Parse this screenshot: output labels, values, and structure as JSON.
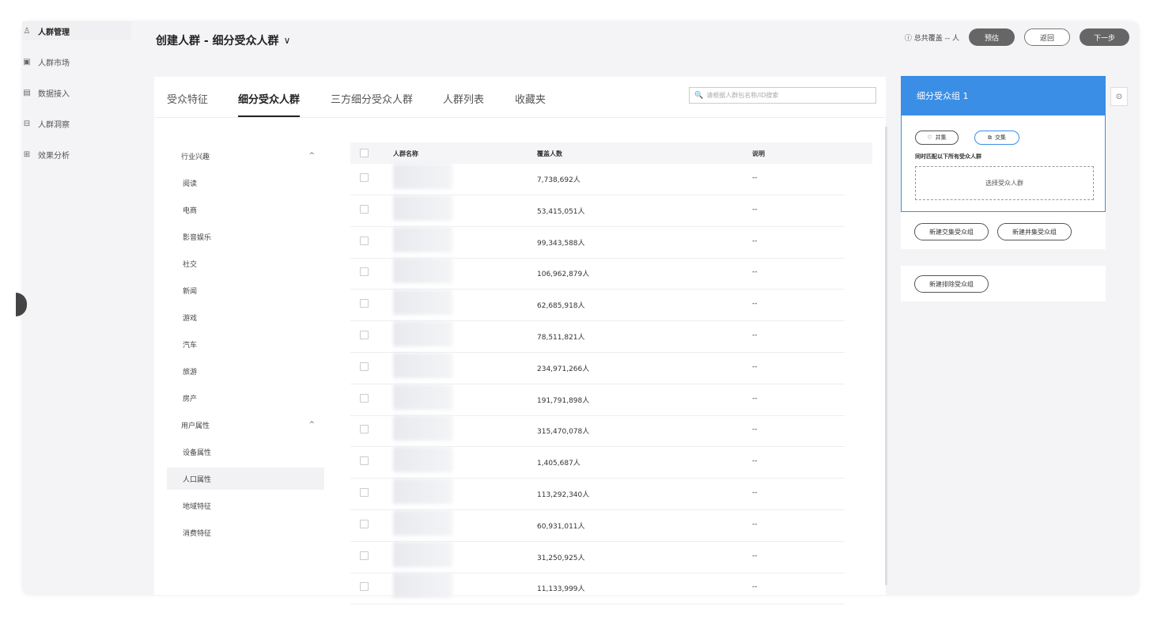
{
  "sidebar": {
    "items": [
      {
        "icon": "user-group-icon",
        "glyph": "♙",
        "label": "人群管理"
      },
      {
        "icon": "market-icon",
        "glyph": "▣",
        "label": "人群市场"
      },
      {
        "icon": "data-import-icon",
        "glyph": "▤",
        "label": "数据接入"
      },
      {
        "icon": "insight-icon",
        "glyph": "⊟",
        "label": "人群洞察"
      },
      {
        "icon": "analysis-icon",
        "glyph": "⊞",
        "label": "效果分析"
      }
    ]
  },
  "header": {
    "title": "创建人群 - 细分受众人群",
    "chevron": "∨",
    "coverage_icon": "ⓘ",
    "coverage_text": "总共覆盖 -- 人",
    "estimate_label": "预估",
    "back_label": "返回",
    "next_label": "下一步"
  },
  "tabs": [
    "受众特征",
    "细分受众人群",
    "三方细分受众人群",
    "人群列表",
    "收藏夹"
  ],
  "search": {
    "icon": "🔍",
    "placeholder": "请根据人群包名称/ID搜索"
  },
  "categories": [
    {
      "label": "行业兴趣",
      "level": 1,
      "caret": "^"
    },
    {
      "label": "阅读",
      "level": 2
    },
    {
      "label": "电商",
      "level": 2
    },
    {
      "label": "影音娱乐",
      "level": 2
    },
    {
      "label": "社交",
      "level": 2
    },
    {
      "label": "新闻",
      "level": 2
    },
    {
      "label": "游戏",
      "level": 2
    },
    {
      "label": "汽车",
      "level": 2
    },
    {
      "label": "旅游",
      "level": 2
    },
    {
      "label": "房产",
      "level": 2
    },
    {
      "label": "用户属性",
      "level": 1,
      "caret": "^"
    },
    {
      "label": "设备属性",
      "level": 2
    },
    {
      "label": "人口属性",
      "level": 2,
      "selected": true
    },
    {
      "label": "地域特征",
      "level": 2
    },
    {
      "label": "消费特征",
      "level": 2
    }
  ],
  "table": {
    "headers": {
      "name": "人群名称",
      "coverage": "覆盖人数",
      "desc": "说明"
    },
    "rows": [
      {
        "coverage": "7,738,692人",
        "desc": "--"
      },
      {
        "coverage": "53,415,051人",
        "desc": "--"
      },
      {
        "coverage": "99,343,588人",
        "desc": "--"
      },
      {
        "coverage": "106,962,879人",
        "desc": "--"
      },
      {
        "coverage": "62,685,918人",
        "desc": "--"
      },
      {
        "coverage": "78,511,821人",
        "desc": "--"
      },
      {
        "coverage": "234,971,266人",
        "desc": "--"
      },
      {
        "coverage": "191,791,898人",
        "desc": "--"
      },
      {
        "coverage": "315,470,078人",
        "desc": "--"
      },
      {
        "coverage": "1,405,687人",
        "desc": "--"
      },
      {
        "coverage": "113,292,340人",
        "desc": "--"
      },
      {
        "coverage": "60,931,011人",
        "desc": "--"
      },
      {
        "coverage": "31,250,925人",
        "desc": "--"
      },
      {
        "coverage": "11,133,999人",
        "desc": "--"
      }
    ]
  },
  "right_panel": {
    "group_title": "细分受众组 1",
    "union_label": "并集",
    "union_glyph": "♡",
    "intersect_label": "交集",
    "intersect_glyph": "⧉",
    "rule_text": "同时匹配以下所有受众人群",
    "select_label": "选择受众人群",
    "new_intersect_group": "新建交集受众组",
    "new_union_group": "新建并集受众组",
    "new_exclude_group": "新建排除受众组",
    "collapse_glyph": "⊙"
  },
  "colors": {
    "accent": "#3a8ee6",
    "dark_button": "#666666"
  }
}
